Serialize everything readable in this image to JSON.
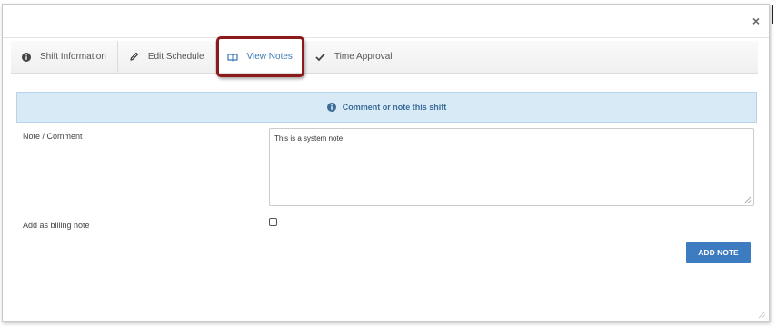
{
  "dialog": {
    "close_label": "×"
  },
  "tabs": [
    {
      "label": "Shift Information",
      "icon": "info-circle-icon",
      "active": false
    },
    {
      "label": "Edit Schedule",
      "icon": "pencil-icon",
      "active": false
    },
    {
      "label": "View Notes",
      "icon": "book-icon",
      "active": true
    },
    {
      "label": "Time Approval",
      "icon": "checkmark-icon",
      "active": false
    }
  ],
  "banner": {
    "text": "Comment or note this shift",
    "icon": "info-circle-icon"
  },
  "form": {
    "note_label": "Note / Comment",
    "note_value": "This is a system note",
    "billing_label": "Add as billing note",
    "billing_checked": false,
    "submit_label": "ADD NOTE"
  },
  "colors": {
    "accent": "#3e7cc2",
    "banner_bg": "#d9eaf7",
    "highlight": "#8b1a1a"
  }
}
